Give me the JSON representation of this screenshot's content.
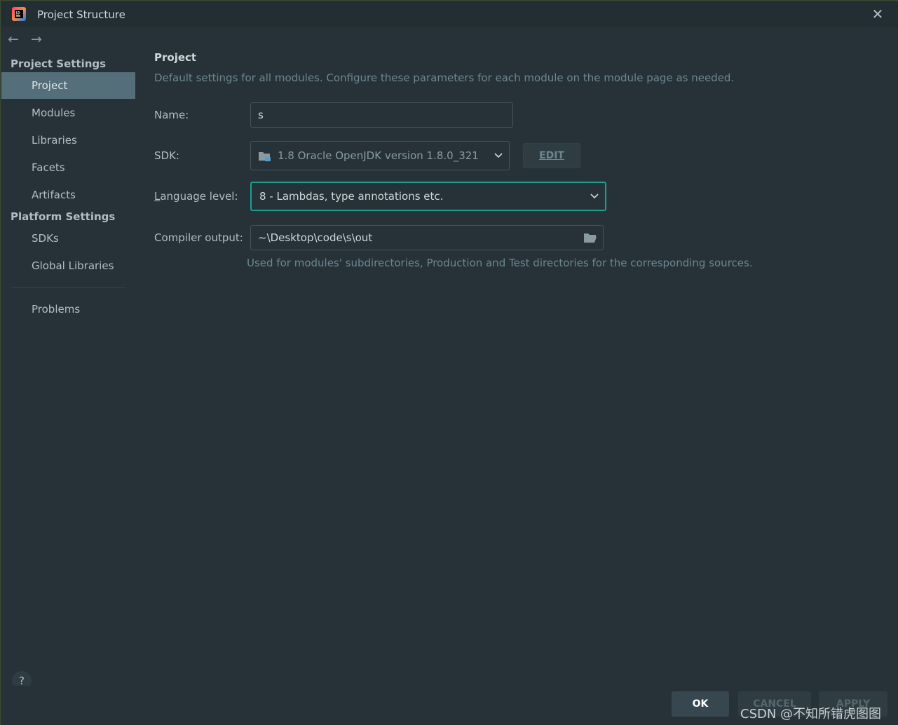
{
  "window": {
    "title": "Project Structure"
  },
  "sidebar": {
    "project_settings_header": "Project Settings",
    "platform_settings_header": "Platform Settings",
    "items": [
      {
        "label": "Project",
        "selected": true
      },
      {
        "label": "Modules"
      },
      {
        "label": "Libraries"
      },
      {
        "label": "Facets"
      },
      {
        "label": "Artifacts"
      },
      {
        "label": "SDKs"
      },
      {
        "label": "Global Libraries"
      },
      {
        "label": "Problems"
      }
    ]
  },
  "main": {
    "title": "Project",
    "description": "Default settings for all modules. Configure these parameters for each module on the module page as needed.",
    "name_label": "Name:",
    "name_value": "s",
    "sdk_label": "SDK:",
    "sdk_value": "1.8 Oracle OpenJDK version 1.8.0_321",
    "edit_button": "EDIT",
    "language_level_label_prefix": "L",
    "language_level_label_rest": "anguage level:",
    "language_level_value": "8 - Lambdas, type annotations etc.",
    "compiler_output_label": "Compiler output:",
    "compiler_output_value": "~\\Desktop\\code\\s\\out",
    "compiler_output_hint": "Used for modules' subdirectories, Production and Test directories for the corresponding sources."
  },
  "footer": {
    "help": "?",
    "ok": "OK",
    "cancel": "CANCEL",
    "apply": "APPLY"
  },
  "watermark": "CSDN @不知所错虎图图",
  "colors": {
    "background": "#263238",
    "selection": "#546e7a",
    "focus_border": "#1e9e8e"
  }
}
